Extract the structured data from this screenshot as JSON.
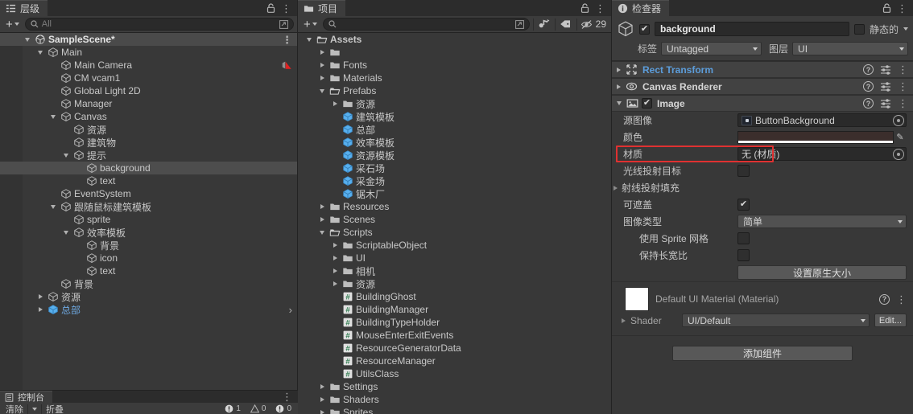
{
  "hierarchy": {
    "tab_label": "层级",
    "tab_icon": "hierarchy-icon",
    "lock_icon": "lock-icon",
    "menu_icon": "kebab-menu-icon",
    "add_label": "+",
    "search_placeholder": "All",
    "search_icon": "search-icon",
    "rows": [
      {
        "label": "SampleScene*",
        "depth": 0,
        "arrow": "down",
        "icon": "unity-scene-icon",
        "style": "scene"
      },
      {
        "label": "Main",
        "depth": 1,
        "arrow": "down",
        "icon": "gameobject-icon"
      },
      {
        "label": "Main Camera",
        "depth": 2,
        "arrow": "none",
        "icon": "gameobject-icon",
        "badge": "camera-audio-icon"
      },
      {
        "label": "CM vcam1",
        "depth": 2,
        "arrow": "none",
        "icon": "gameobject-icon"
      },
      {
        "label": "Global Light 2D",
        "depth": 2,
        "arrow": "none",
        "icon": "gameobject-icon"
      },
      {
        "label": "Manager",
        "depth": 2,
        "arrow": "none",
        "icon": "gameobject-icon"
      },
      {
        "label": "Canvas",
        "depth": 2,
        "arrow": "down",
        "icon": "gameobject-icon"
      },
      {
        "label": "资源",
        "depth": 3,
        "arrow": "none",
        "icon": "gameobject-icon"
      },
      {
        "label": "建筑物",
        "depth": 3,
        "arrow": "none",
        "icon": "gameobject-icon"
      },
      {
        "label": "提示",
        "depth": 3,
        "arrow": "down",
        "icon": "gameobject-icon"
      },
      {
        "label": "background",
        "depth": 4,
        "arrow": "none",
        "icon": "gameobject-icon",
        "style": "selected"
      },
      {
        "label": "text",
        "depth": 4,
        "arrow": "none",
        "icon": "gameobject-icon"
      },
      {
        "label": "EventSystem",
        "depth": 2,
        "arrow": "none",
        "icon": "gameobject-icon"
      },
      {
        "label": "跟随鼠标建筑模板",
        "depth": 2,
        "arrow": "down",
        "icon": "gameobject-icon"
      },
      {
        "label": "sprite",
        "depth": 3,
        "arrow": "none",
        "icon": "gameobject-icon"
      },
      {
        "label": "效率模板",
        "depth": 3,
        "arrow": "down",
        "icon": "gameobject-icon"
      },
      {
        "label": "背景",
        "depth": 4,
        "arrow": "none",
        "icon": "gameobject-icon"
      },
      {
        "label": "icon",
        "depth": 4,
        "arrow": "none",
        "icon": "gameobject-icon"
      },
      {
        "label": "text",
        "depth": 4,
        "arrow": "none",
        "icon": "gameobject-icon"
      },
      {
        "label": "背景",
        "depth": 2,
        "arrow": "none",
        "icon": "gameobject-icon"
      },
      {
        "label": "资源",
        "depth": 1,
        "arrow": "right",
        "icon": "gameobject-icon"
      },
      {
        "label": "总部",
        "depth": 1,
        "arrow": "right",
        "icon": "prefab-icon",
        "style": "prefab",
        "overflow": "›"
      }
    ]
  },
  "project": {
    "tab_label": "项目",
    "tab_icon": "folder-icon",
    "lock_icon": "lock-icon",
    "menu_icon": "kebab-menu-icon",
    "add_label": "+",
    "search_placeholder": "",
    "search_icon": "search-icon",
    "toolbar_icons": [
      "search-by-type-icon",
      "search-by-label-icon",
      "hidden-packages-icon"
    ],
    "hidden_count": "29",
    "rows": [
      {
        "label": "Assets",
        "depth": 0,
        "arrow": "down",
        "icon": "folder-open-icon",
        "bold": true
      },
      {
        "label": "",
        "depth": 1,
        "arrow": "right",
        "icon": "folder-icon"
      },
      {
        "label": "Fonts",
        "depth": 1,
        "arrow": "right",
        "icon": "folder-icon"
      },
      {
        "label": "Materials",
        "depth": 1,
        "arrow": "right",
        "icon": "folder-icon"
      },
      {
        "label": "Prefabs",
        "depth": 1,
        "arrow": "down",
        "icon": "folder-open-icon"
      },
      {
        "label": "资源",
        "depth": 2,
        "arrow": "right",
        "icon": "folder-icon"
      },
      {
        "label": "建筑模板",
        "depth": 2,
        "arrow": "none",
        "icon": "prefab-icon"
      },
      {
        "label": "总部",
        "depth": 2,
        "arrow": "none",
        "icon": "prefab-icon"
      },
      {
        "label": "效率模板",
        "depth": 2,
        "arrow": "none",
        "icon": "prefab-icon"
      },
      {
        "label": "资源模板",
        "depth": 2,
        "arrow": "none",
        "icon": "prefab-icon"
      },
      {
        "label": "采石场",
        "depth": 2,
        "arrow": "none",
        "icon": "prefab-icon"
      },
      {
        "label": "采金场",
        "depth": 2,
        "arrow": "none",
        "icon": "prefab-icon"
      },
      {
        "label": "锯木厂",
        "depth": 2,
        "arrow": "none",
        "icon": "prefab-icon"
      },
      {
        "label": "Resources",
        "depth": 1,
        "arrow": "right",
        "icon": "folder-icon"
      },
      {
        "label": "Scenes",
        "depth": 1,
        "arrow": "right",
        "icon": "folder-icon"
      },
      {
        "label": "Scripts",
        "depth": 1,
        "arrow": "down",
        "icon": "folder-open-icon"
      },
      {
        "label": "ScriptableObject",
        "depth": 2,
        "arrow": "right",
        "icon": "folder-icon"
      },
      {
        "label": "UI",
        "depth": 2,
        "arrow": "right",
        "icon": "folder-icon"
      },
      {
        "label": "相机",
        "depth": 2,
        "arrow": "right",
        "icon": "folder-icon"
      },
      {
        "label": "资源",
        "depth": 2,
        "arrow": "right",
        "icon": "folder-icon"
      },
      {
        "label": "BuildingGhost",
        "depth": 2,
        "arrow": "none",
        "icon": "csharp-script-icon"
      },
      {
        "label": "BuildingManager",
        "depth": 2,
        "arrow": "none",
        "icon": "csharp-script-icon"
      },
      {
        "label": "BuildingTypeHolder",
        "depth": 2,
        "arrow": "none",
        "icon": "csharp-script-icon"
      },
      {
        "label": "MouseEnterExitEvents",
        "depth": 2,
        "arrow": "none",
        "icon": "csharp-script-icon"
      },
      {
        "label": "ResourceGeneratorData",
        "depth": 2,
        "arrow": "none",
        "icon": "csharp-script-icon"
      },
      {
        "label": "ResourceManager",
        "depth": 2,
        "arrow": "none",
        "icon": "csharp-script-icon"
      },
      {
        "label": "UtilsClass",
        "depth": 2,
        "arrow": "none",
        "icon": "csharp-script-icon"
      },
      {
        "label": "Settings",
        "depth": 1,
        "arrow": "right",
        "icon": "folder-icon"
      },
      {
        "label": "Shaders",
        "depth": 1,
        "arrow": "right",
        "icon": "folder-icon"
      },
      {
        "label": "Sprites",
        "depth": 1,
        "arrow": "right",
        "icon": "folder-icon"
      }
    ]
  },
  "inspector": {
    "tab_label": "检查器",
    "tab_icon": "info-icon",
    "lock_icon": "lock-icon",
    "menu_icon": "kebab-menu-icon",
    "object": {
      "enabled": true,
      "name": "background",
      "static_label": "静态的",
      "static_checked": false,
      "tag_label": "标签",
      "tag_value": "Untagged",
      "layer_label": "图层",
      "layer_value": "UI",
      "prefab_icon": "gameobject-icon"
    },
    "components": [
      {
        "title": "Rect Transform",
        "expanded": false,
        "icon": "rect-transform-icon",
        "link": true
      },
      {
        "title": "Canvas Renderer",
        "expanded": false,
        "icon": "canvas-renderer-icon",
        "link": false
      },
      {
        "title": "Image",
        "expanded": true,
        "icon": "image-component-icon",
        "checkbox": true,
        "link": false
      }
    ],
    "image_props": {
      "source_image_label": "源图像",
      "source_image_value": "ButtonBackground",
      "color_label": "颜色",
      "color_value": "#3b2e2c",
      "material_label": "材质",
      "material_value": "无 (材质)",
      "raycast_target_label": "光线投射目标",
      "raycast_target_checked": false,
      "raycast_padding_label": "射线投射填充",
      "maskable_label": "可遮盖",
      "maskable_checked": true,
      "image_type_label": "图像类型",
      "image_type_value": "简单",
      "use_sprite_mesh_label": "使用 Sprite 网格",
      "use_sprite_mesh_checked": false,
      "preserve_aspect_label": "保持长宽比",
      "preserve_aspect_checked": false,
      "set_native_size_label": "设置原生大小"
    },
    "material": {
      "name": "Default UI Material (Material)",
      "shader_label": "Shader",
      "shader_value": "UI/Default",
      "edit_label": "Edit..."
    },
    "add_component_label": "添加组件"
  },
  "console": {
    "tab_label": "控制台",
    "tab_icon": "console-icon",
    "menu_icon": "kebab-menu-icon",
    "clear_label": "清除",
    "collapse_label": "折叠",
    "error_count": "1",
    "warning_count": "0",
    "info_count": "0"
  },
  "colors": {
    "accent_blue": "#5c9ddb",
    "prefab_blue": "#6ea8e0",
    "highlight_red": "#e03131",
    "panel_bg": "#383838",
    "header_bg": "#3c3c3c",
    "selection": "#4d4d4d"
  }
}
